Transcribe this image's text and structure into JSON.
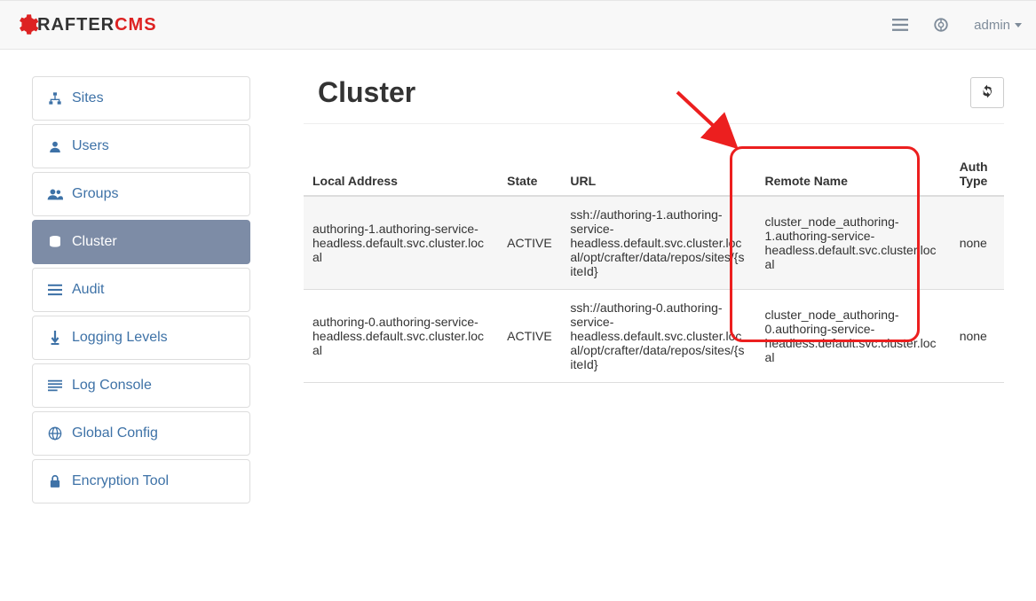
{
  "brand": {
    "name": "RAFTER",
    "suffix": "CMS"
  },
  "user": {
    "label": "admin"
  },
  "sidebar": {
    "items": [
      {
        "label": "Sites",
        "icon": "sitemap"
      },
      {
        "label": "Users",
        "icon": "user"
      },
      {
        "label": "Groups",
        "icon": "users"
      },
      {
        "label": "Cluster",
        "icon": "db",
        "active": true
      },
      {
        "label": "Audit",
        "icon": "list"
      },
      {
        "label": "Logging Levels",
        "icon": "levels"
      },
      {
        "label": "Log Console",
        "icon": "lines"
      },
      {
        "label": "Global Config",
        "icon": "globe"
      },
      {
        "label": "Encryption Tool",
        "icon": "lock"
      }
    ]
  },
  "page": {
    "title": "Cluster"
  },
  "table": {
    "headers": [
      "Local Address",
      "State",
      "URL",
      "Remote Name",
      "Auth Type"
    ],
    "rows": [
      {
        "local": "authoring-1.authoring-service-headless.default.svc.cluster.local",
        "state": "ACTIVE",
        "url": "ssh://authoring-1.authoring-service-headless.default.svc.cluster.local/opt/crafter/data/repos/sites/{siteId}",
        "remote": "cluster_node_authoring-1.authoring-service-headless.default.svc.cluster.local",
        "auth": "none"
      },
      {
        "local": "authoring-0.authoring-service-headless.default.svc.cluster.local",
        "state": "ACTIVE",
        "url": "ssh://authoring-0.authoring-service-headless.default.svc.cluster.local/opt/crafter/data/repos/sites/{siteId}",
        "remote": "cluster_node_authoring-0.authoring-service-headless.default.svc.cluster.local",
        "auth": "none"
      }
    ]
  }
}
